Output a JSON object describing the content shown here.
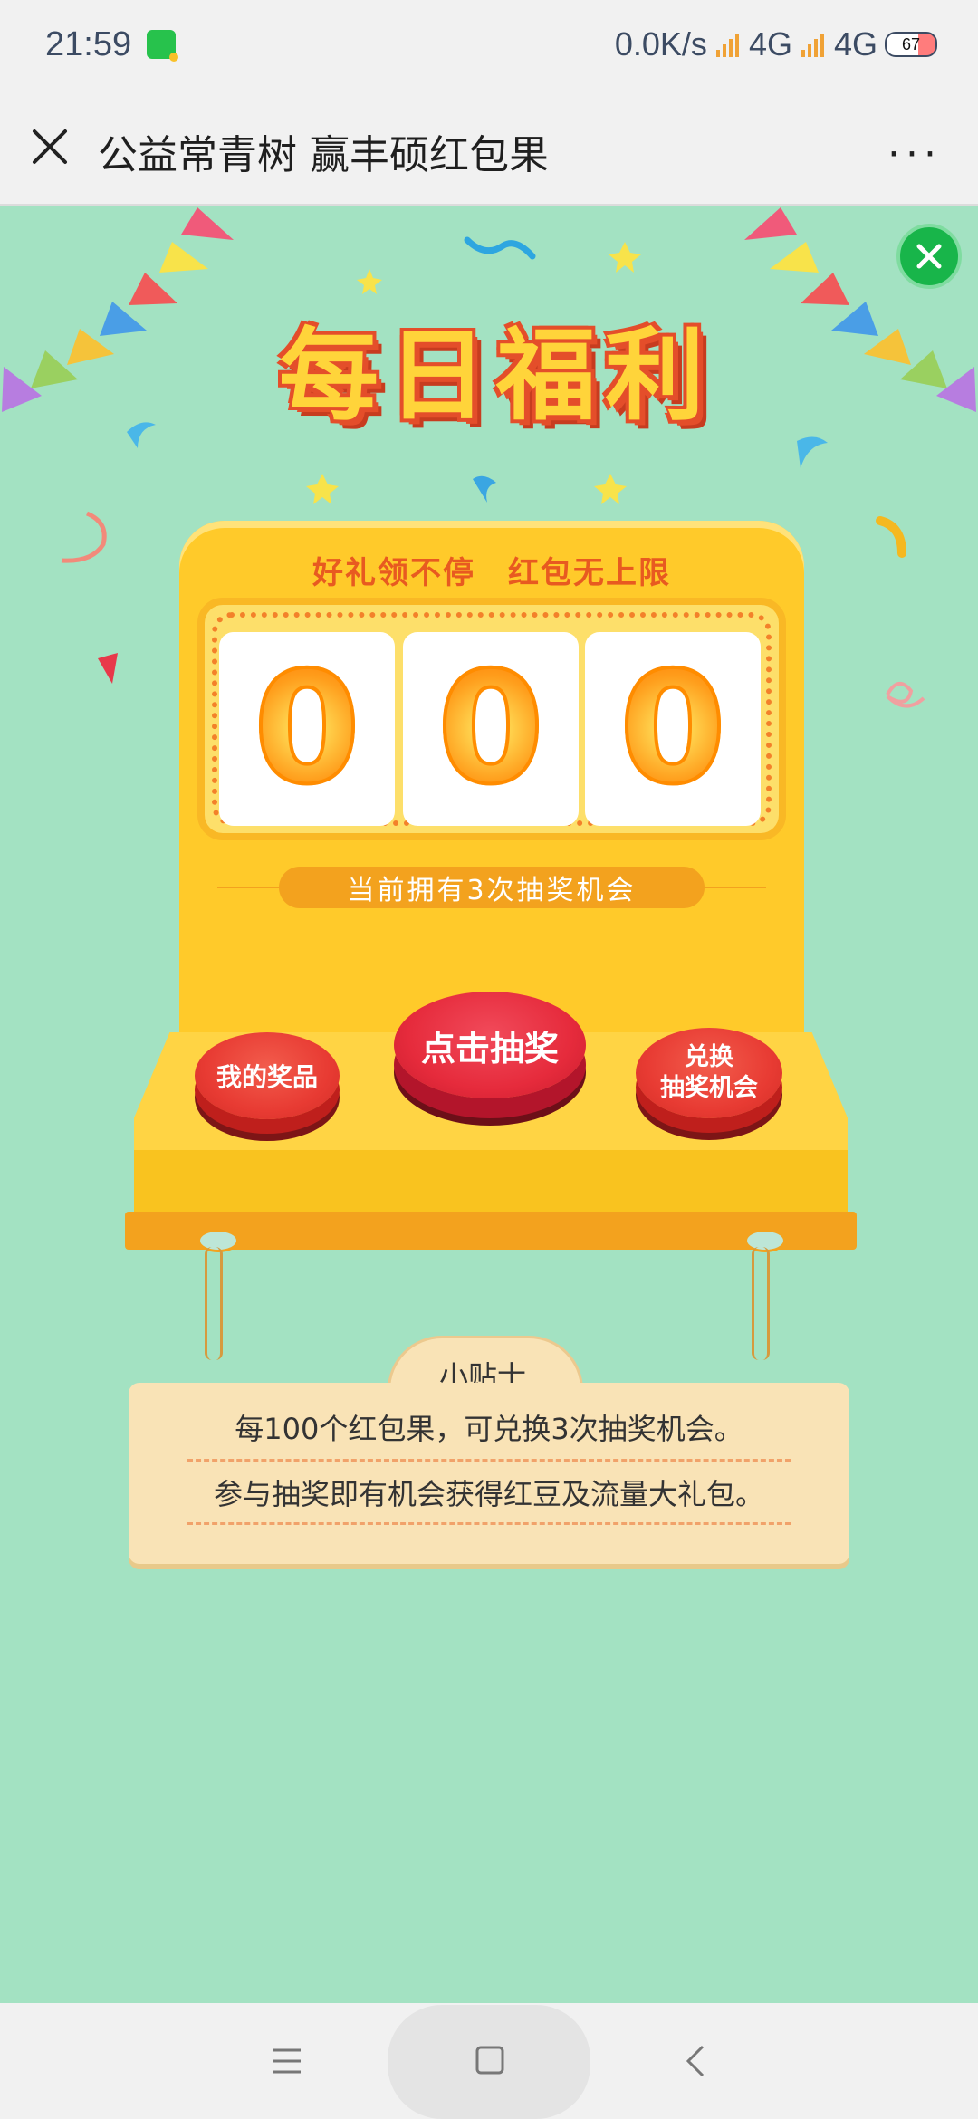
{
  "status_bar": {
    "time": "21:59",
    "network_speed": "0.0K/s",
    "signal1_label": "4G",
    "signal2_label": "4G",
    "battery": "67"
  },
  "header": {
    "title": "公益常青树 赢丰硕红包果",
    "more": "···"
  },
  "banner": {
    "title": "每日福利"
  },
  "machine": {
    "slogan": "好礼领不停　红包无上限",
    "reels": [
      "0",
      "0",
      "0"
    ],
    "chance_text": "当前拥有3次抽奖机会",
    "my_prizes_label": "我的奖品",
    "draw_label": "点击抽奖",
    "exchange_label_line1": "兑换",
    "exchange_label_line2": "抽奖机会"
  },
  "tips": {
    "title": "小贴士",
    "line1": "每100个红包果，可兑换3次抽奖机会。",
    "line2": "参与抽奖即有机会获得红豆及流量大礼包。"
  },
  "colors": {
    "background": "#a3e2c2",
    "machine": "#ffca2a",
    "button_red": "#e83b33",
    "close_green": "#18b54a"
  },
  "icons": {
    "close": "close-icon",
    "more": "more-icon",
    "green_close": "close-circle-icon",
    "nav_menu": "menu-icon",
    "nav_home": "home-icon",
    "nav_back": "back-icon"
  }
}
